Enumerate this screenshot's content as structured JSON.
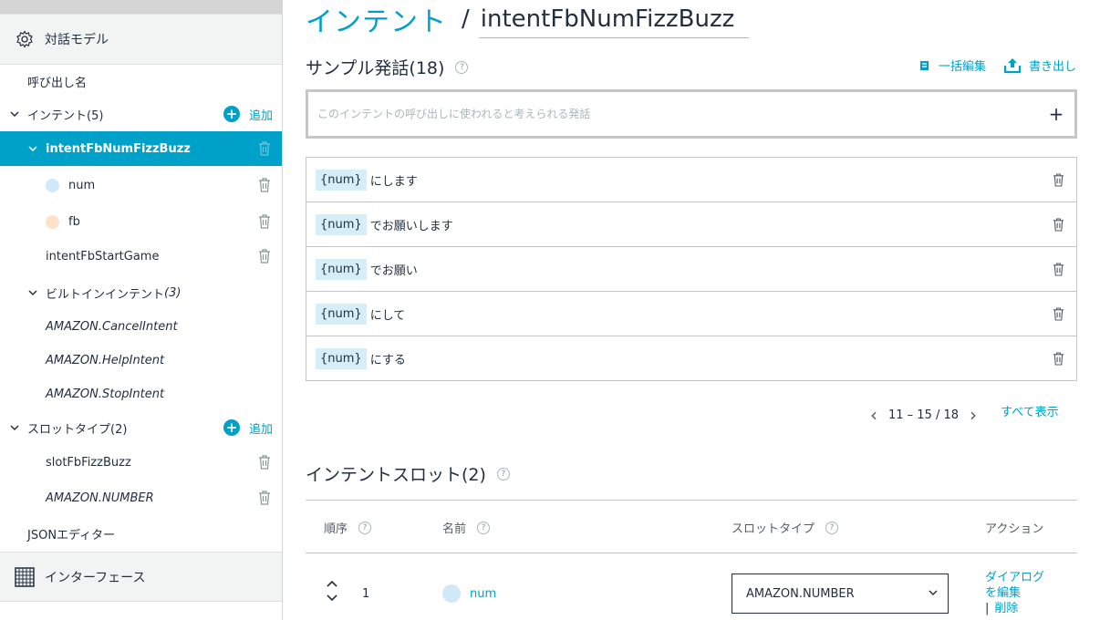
{
  "sidebar": {
    "dialog_model_label": "対話モデル",
    "invocation_label": "呼び出し名",
    "intents_label": "インテント(5)",
    "add_label": "追加",
    "selected_intent": "intentFbNumFizzBuzz",
    "slots": [
      {
        "name": "num",
        "color": "#cfe9f9"
      },
      {
        "name": "fb",
        "color": "#fde2c8"
      }
    ],
    "other_intent": "intentFbStartGame",
    "builtin_label": "ビルトインインテント",
    "builtin_count": "(3)",
    "builtin_intents": [
      "AMAZON.CancelIntent",
      "AMAZON.HelpIntent",
      "AMAZON.StopIntent"
    ],
    "slot_types_label": "スロットタイプ(2)",
    "slot_types": [
      "slotFbFizzBuzz",
      "AMAZON.NUMBER"
    ],
    "json_editor_label": "JSONエディター",
    "interfaces_label": "インターフェース"
  },
  "main": {
    "breadcrumb": "インテント",
    "intent_name": "intentFbNumFizzBuzz",
    "utterances_heading": "サンプル発話(18)",
    "bulk_edit_label": "一括編集",
    "export_label": "書き出し",
    "utterance_placeholder": "このインテントの呼び出しに使われると考えられる発話",
    "slot_token": "{num}",
    "utterances": [
      "にします",
      "でお願いします",
      "でお願い",
      "にして",
      "にする"
    ],
    "pager_text": "11 – 15 / 18",
    "show_all_label": "すべて表示",
    "slots_heading": "インテントスロット(2)",
    "columns": {
      "order": "順序",
      "name": "名前",
      "slot_type": "スロットタイプ",
      "action": "アクション"
    },
    "slot_row": {
      "order": "1",
      "name": "num",
      "slot_type": "AMAZON.NUMBER",
      "edit_dialog_line1": "ダイアログ",
      "edit_dialog_line2": "を編集",
      "delete_label": "削除"
    }
  },
  "colors": {
    "accent": "#00a1c9",
    "selected_bg": "#00a1c9",
    "chip_bg": "#d5eef8"
  }
}
